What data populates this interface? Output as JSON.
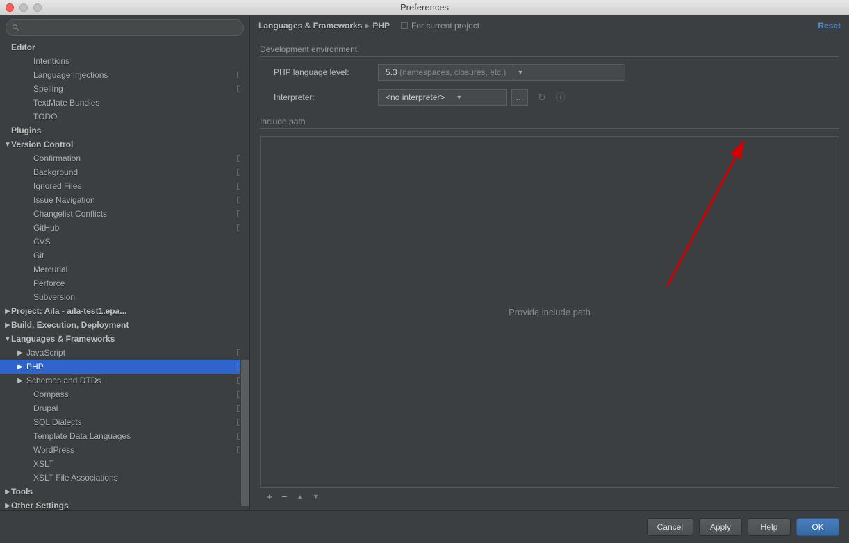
{
  "window_title": "Preferences",
  "search_placeholder": "",
  "breadcrumb": {
    "parent": "Languages & Frameworks",
    "current": "PHP",
    "for_current": "For current project",
    "reset": "Reset"
  },
  "dev_env": {
    "section": "Development environment",
    "lang_level_label": "PHP language level:",
    "lang_level_value": "5.3",
    "lang_level_hint": "(namespaces, closures, etc.)",
    "interpreter_label": "Interpreter:",
    "interpreter_value": "<no interpreter>"
  },
  "include": {
    "section": "Include path",
    "placeholder": "Provide include path"
  },
  "footer": {
    "cancel": "Cancel",
    "apply_u": "A",
    "apply_rest": "pply",
    "help": "Help",
    "ok": "OK"
  },
  "tree": [
    {
      "kind": "cat",
      "label": "Editor",
      "indent": 0,
      "arrow": ""
    },
    {
      "kind": "leaf",
      "label": "Intentions",
      "indent": 1
    },
    {
      "kind": "leaf",
      "label": "Language Injections",
      "indent": 1,
      "proj": true
    },
    {
      "kind": "leaf",
      "label": "Spelling",
      "indent": 1,
      "proj": true
    },
    {
      "kind": "leaf",
      "label": "TextMate Bundles",
      "indent": 1
    },
    {
      "kind": "leaf",
      "label": "TODO",
      "indent": 1
    },
    {
      "kind": "cat",
      "label": "Plugins",
      "indent": 0,
      "arrow": ""
    },
    {
      "kind": "cat",
      "label": "Version Control",
      "indent": 0,
      "arrow": "▼"
    },
    {
      "kind": "leaf",
      "label": "Confirmation",
      "indent": 1,
      "proj": true
    },
    {
      "kind": "leaf",
      "label": "Background",
      "indent": 1,
      "proj": true
    },
    {
      "kind": "leaf",
      "label": "Ignored Files",
      "indent": 1,
      "proj": true
    },
    {
      "kind": "leaf",
      "label": "Issue Navigation",
      "indent": 1,
      "proj": true
    },
    {
      "kind": "leaf",
      "label": "Changelist Conflicts",
      "indent": 1,
      "proj": true
    },
    {
      "kind": "leaf",
      "label": "GitHub",
      "indent": 1,
      "proj": true
    },
    {
      "kind": "leaf",
      "label": "CVS",
      "indent": 1
    },
    {
      "kind": "leaf",
      "label": "Git",
      "indent": 1
    },
    {
      "kind": "leaf",
      "label": "Mercurial",
      "indent": 1
    },
    {
      "kind": "leaf",
      "label": "Perforce",
      "indent": 1
    },
    {
      "kind": "leaf",
      "label": "Subversion",
      "indent": 1
    },
    {
      "kind": "cat",
      "label": "Project: Aila - aila-test1.epa...",
      "indent": 0,
      "arrow": "▶"
    },
    {
      "kind": "cat",
      "label": "Build, Execution, Deployment",
      "indent": 0,
      "arrow": "▶"
    },
    {
      "kind": "cat",
      "label": "Languages & Frameworks",
      "indent": 0,
      "arrow": "▼"
    },
    {
      "kind": "leaf",
      "label": "JavaScript",
      "indent": 2,
      "arrow": "▶",
      "proj": true
    },
    {
      "kind": "leaf",
      "label": "PHP",
      "indent": 2,
      "arrow": "▶",
      "proj": true,
      "sel": true
    },
    {
      "kind": "leaf",
      "label": "Schemas and DTDs",
      "indent": 2,
      "arrow": "▶",
      "proj": true
    },
    {
      "kind": "leaf",
      "label": "Compass",
      "indent": 1,
      "proj": true
    },
    {
      "kind": "leaf",
      "label": "Drupal",
      "indent": 1,
      "proj": true
    },
    {
      "kind": "leaf",
      "label": "SQL Dialects",
      "indent": 1,
      "proj": true
    },
    {
      "kind": "leaf",
      "label": "Template Data Languages",
      "indent": 1,
      "proj": true
    },
    {
      "kind": "leaf",
      "label": "WordPress",
      "indent": 1,
      "proj": true
    },
    {
      "kind": "leaf",
      "label": "XSLT",
      "indent": 1
    },
    {
      "kind": "leaf",
      "label": "XSLT File Associations",
      "indent": 1
    },
    {
      "kind": "cat",
      "label": "Tools",
      "indent": 0,
      "arrow": "▶"
    },
    {
      "kind": "cat",
      "label": "Other Settings",
      "indent": 0,
      "arrow": "▶"
    }
  ]
}
